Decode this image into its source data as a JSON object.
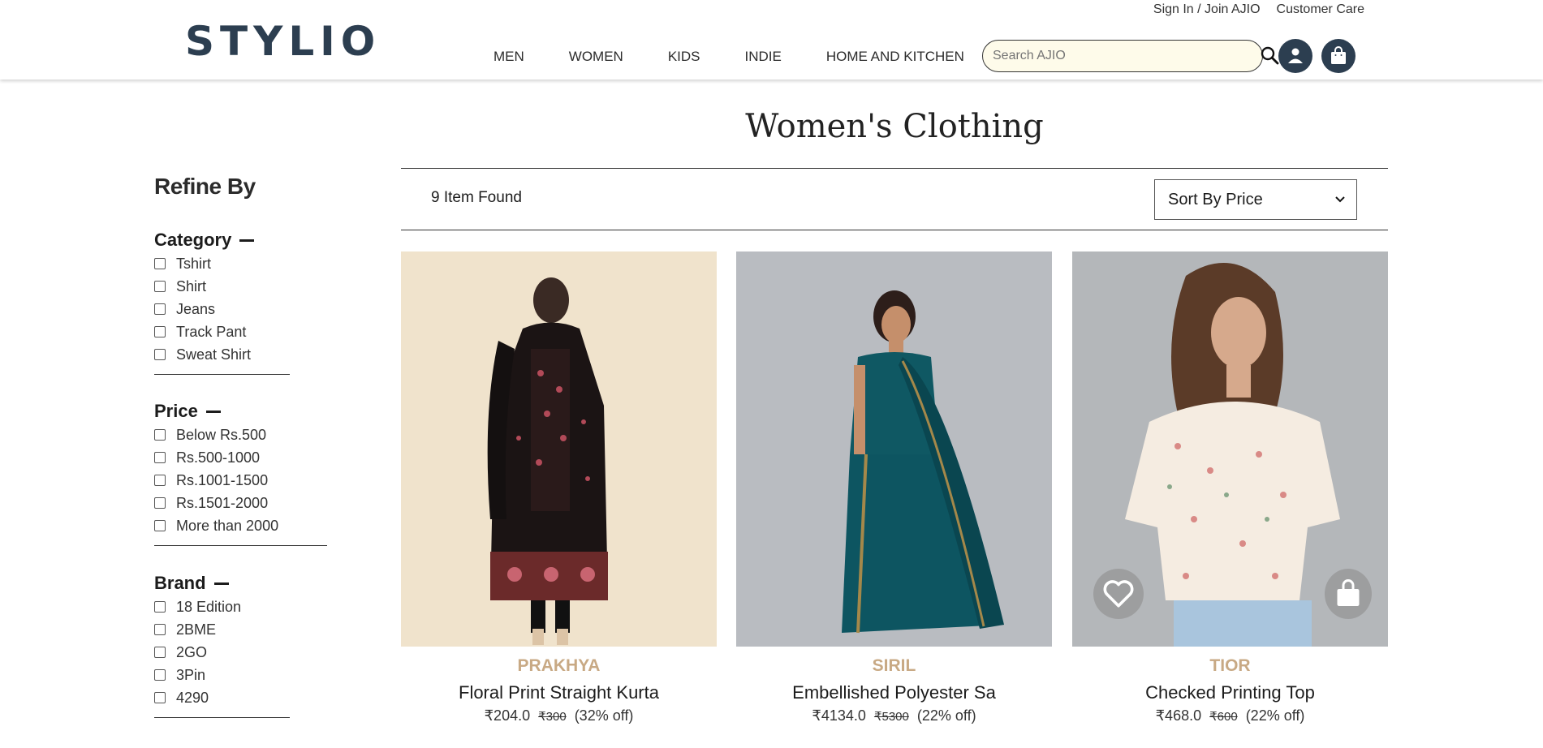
{
  "header": {
    "logo": "STYLIO",
    "top_links": [
      "Sign In / Join AJIO",
      "Customer Care"
    ],
    "nav": [
      "MEN",
      "WOMEN",
      "KIDS",
      "INDIE",
      "HOME AND KITCHEN"
    ],
    "search_placeholder": "Search AJIO"
  },
  "page": {
    "title": "Women's Clothing",
    "item_count": "9 Item Found",
    "sort_label": "Sort By Price"
  },
  "sidebar": {
    "title": "Refine By",
    "filters": [
      {
        "heading": "Category",
        "options": [
          "Tshirt",
          "Shirt",
          "Jeans",
          "Track Pant",
          "Sweat Shirt"
        ]
      },
      {
        "heading": "Price",
        "options": [
          "Below Rs.500",
          "Rs.500-1000",
          "Rs.1001-1500",
          "Rs.1501-2000",
          "More than 2000"
        ]
      },
      {
        "heading": "Brand",
        "options": [
          "18 Edition",
          "2BME",
          "2GO",
          "3Pin",
          "4290"
        ]
      }
    ]
  },
  "products": [
    {
      "brand": "PRAKHYA",
      "name": "Floral Print Straight Kurta",
      "price": "₹204.0",
      "mrp": "₹300",
      "discount": "(32% off)"
    },
    {
      "brand": "SIRIL",
      "name": "Embellished Polyester Sa",
      "price": "₹4134.0",
      "mrp": "₹5300",
      "discount": "(22% off)"
    },
    {
      "brand": "TIOR",
      "name": "Checked Printing Top",
      "price": "₹468.0",
      "mrp": "₹600",
      "discount": "(22% off)"
    }
  ],
  "colors": {
    "brand_navy": "#2c3e50",
    "brand_gold": "#c8a984",
    "search_bg": "#fefbea"
  }
}
